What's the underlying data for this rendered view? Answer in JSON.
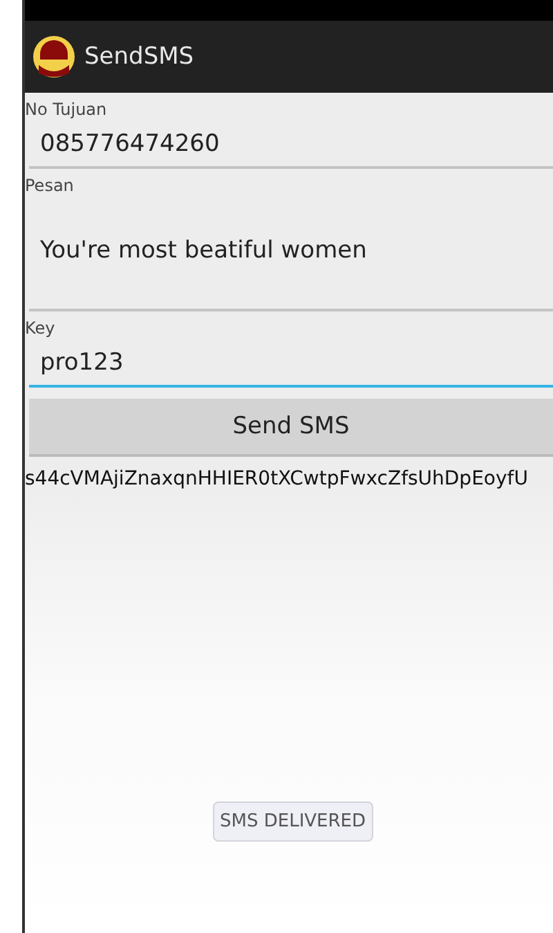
{
  "app_bar": {
    "title": "SendSMS"
  },
  "fields": [
    {
      "label": "No Tujuan",
      "value": "085776474260",
      "multiline": false,
      "focused": false
    },
    {
      "label": "Pesan",
      "value": "You're most beatiful women",
      "multiline": true,
      "focused": false
    },
    {
      "label": "Key",
      "value": "pro123",
      "multiline": false,
      "focused": true
    }
  ],
  "send_button": "Send SMS",
  "output": "s44cVMAjiZnaxqnHHIER0tXCwtpFwxcZfsUhDpEoyfU",
  "toast": "SMS DELIVERED"
}
